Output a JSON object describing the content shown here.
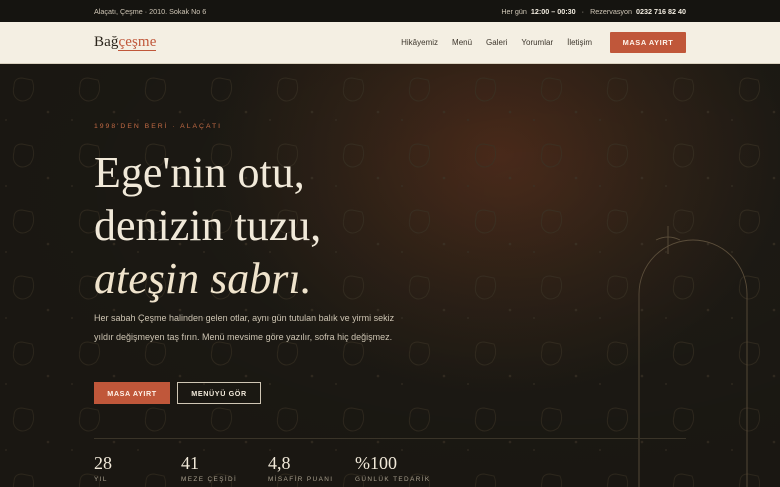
{
  "topbar": {
    "address": "Alaçatı, Çeşme · 2010. Sokak No 6",
    "hours_prefix": "Her gün",
    "hours": "12:00 – 00:30",
    "sep": " · ",
    "reservation_label": "Rezervasyon",
    "phone": "0232 716 82 40"
  },
  "nav": {
    "logo_main": "Bağ",
    "logo_accent": "çeşme",
    "links": [
      "Hikâyemiz",
      "Menü",
      "Galeri",
      "Yorumlar",
      "İletişim"
    ],
    "cta": "MASA AYIRT"
  },
  "hero": {
    "eyebrow": "1998'DEN BERİ · ALAÇATI",
    "headline": [
      "Ege'nin otu,",
      "denizin tuzu,",
      "ateşin sabrı."
    ],
    "lede": "Her sabah Çeşme halinden gelen otlar, aynı gün tutulan balık ve yirmi sekiz yıldır değişmeyen taş fırın. Menü mevsime göre yazılır, sofra hiç değişmez.",
    "primary_button": "MASA AYIRT",
    "secondary_button": "MENÜYÜ GÖR"
  },
  "stats": [
    {
      "value": "28",
      "label": "YIL"
    },
    {
      "value": "41",
      "label": "MEZE ÇEŞİDİ"
    },
    {
      "value": "4,8",
      "label": "MİSAFİR PUANI"
    },
    {
      "value": "%100",
      "label": "GÜNLÜK TEDARİK"
    }
  ],
  "colors": {
    "accent": "#c0573a",
    "cream": "#f4efe3",
    "dark": "#1d1a14",
    "topbar": "#151410"
  },
  "icons": [
    "leaf-pattern-icon",
    "arch-outline-icon"
  ]
}
